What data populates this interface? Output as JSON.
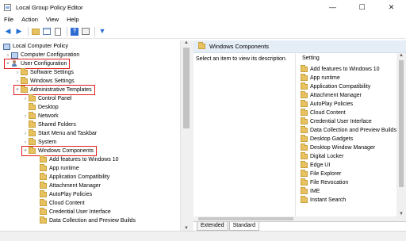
{
  "window": {
    "title": "Local Group Policy Editor",
    "controls": {
      "minimize": "—",
      "maximize": "☐",
      "close": "✕"
    }
  },
  "menu": [
    "File",
    "Action",
    "View",
    "Help"
  ],
  "toolbar": {
    "buttons": [
      "back-arrow",
      "forward-arrow",
      "up-folder",
      "show-hide-tree",
      "export-list",
      "help",
      "properties",
      "filter"
    ]
  },
  "tree": {
    "root": "Local Computer Policy",
    "computer_configuration": "Computer Configuration",
    "user_configuration": "User Configuration",
    "software_settings": "Software Settings",
    "windows_settings": "Windows Settings",
    "administrative_templates": "Administrative Templates",
    "admin_children": [
      "Control Panel",
      "Desktop",
      "Network",
      "Shared Folders",
      "Start Menu and Taskbar",
      "System"
    ],
    "windows_components": "Windows Components",
    "wc_children": [
      "Add features to Windows 10",
      "App runtime",
      "Application Compatibility",
      "Attachment Manager",
      "AutoPlay Policies",
      "Cloud Content",
      "Credential User Interface",
      "Data Collection and Preview Builds"
    ]
  },
  "details": {
    "header": "Windows Components",
    "description": "Select an item to view its description.",
    "column": "Setting",
    "items": [
      "Add features to Windows 10",
      "App runtime",
      "Application Compatibility",
      "Attachment Manager",
      "AutoPlay Policies",
      "Cloud Content",
      "Credential User Interface",
      "Data Collection and Preview Builds",
      "Desktop Gadgets",
      "Desktop Window Manager",
      "Digital Locker",
      "Edge UI",
      "File Explorer",
      "File Revocation",
      "IME",
      "Instant Search"
    ]
  },
  "tabs": [
    "Extended",
    "Standard"
  ],
  "colors": {
    "highlight_box": "#e01b1b",
    "folder": "#e8c160",
    "header_bg": "#e5edf7"
  }
}
